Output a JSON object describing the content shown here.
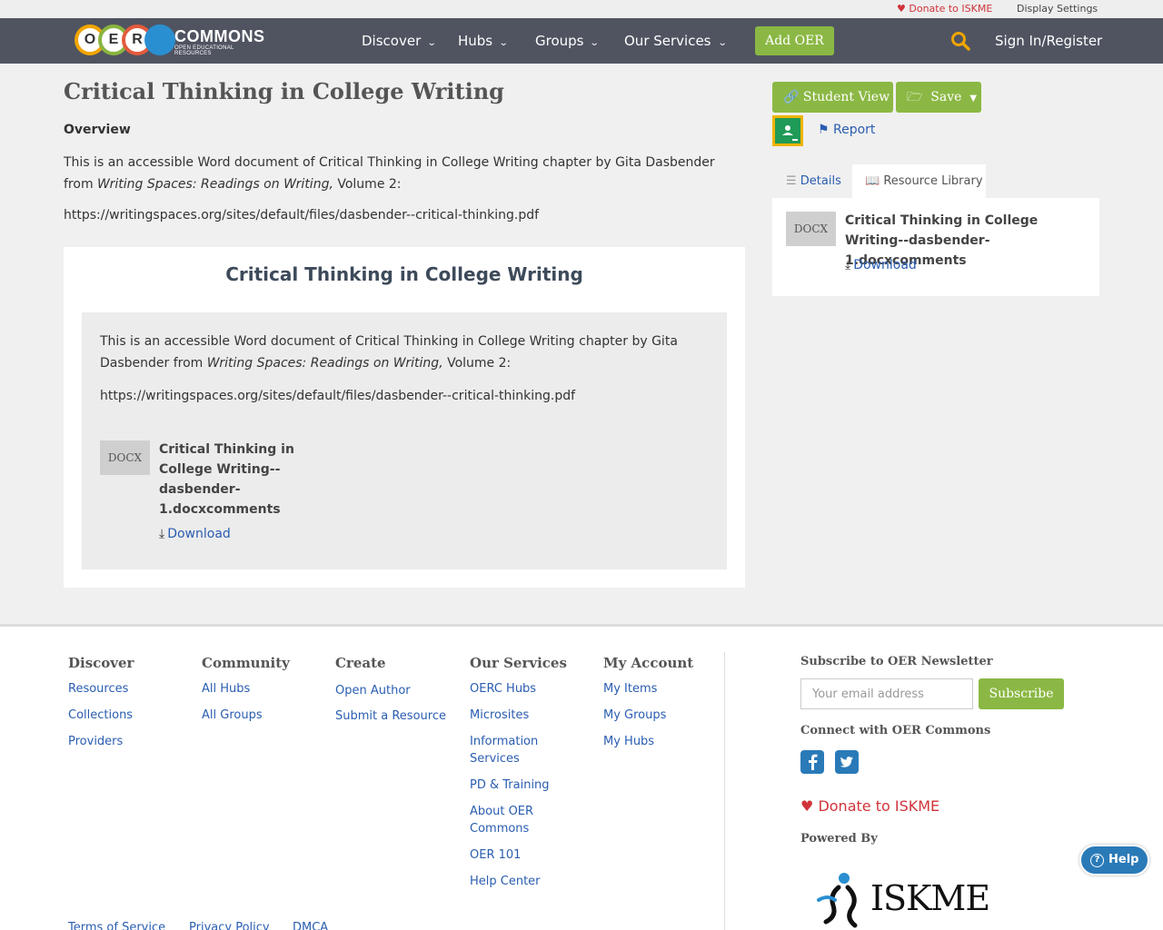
{
  "utility": {
    "donate": "Donate to ISKME",
    "display_settings": "Display Settings"
  },
  "header": {
    "logo_letters": [
      "O",
      "E",
      "R"
    ],
    "logo_word": "COMMONS",
    "logo_sub": "OPEN EDUCATIONAL RESOURCES",
    "nav": [
      "Discover",
      "Hubs",
      "Groups",
      "Our Services"
    ],
    "add_oer": "Add OER",
    "signin": "Sign In/Register"
  },
  "main": {
    "title": "Critical Thinking in College Writing",
    "overview_heading": "Overview",
    "overview_text_a": "This is an accessible Word document of Critical Thinking in College Writing chapter by Gita Dasbender from ",
    "overview_text_em": "Writing Spaces: Readings on Writing,",
    "overview_text_b": " Volume 2:",
    "overview_url": "https://writingspaces.org/sites/default/files/dasbender--critical-thinking.pdf",
    "card_title": "Critical Thinking in College Writing",
    "card_text_a": "This is an accessible Word document of Critical Thinking in College Writing chapter by Gita Dasbender from ",
    "card_text_em": "Writing Spaces: Readings on Writing,",
    "card_text_b": " Volume 2:",
    "card_url": "https://writingspaces.org/sites/default/files/dasbender--critical-thinking.pdf",
    "file_badge": "DOCX",
    "file_name": "Critical Thinking in College Writing--dasbender-1.docxcomments",
    "download": "Download"
  },
  "sidebar": {
    "student_view": "Student View",
    "save": "Save",
    "report": "Report",
    "tabs": [
      "Details",
      "Resource Library"
    ],
    "file_badge": "DOCX",
    "file_name": "Critical Thinking in College Writing--dasbender-1.docxcomments",
    "download": "Download"
  },
  "footer": {
    "columns": [
      {
        "heading": "Discover",
        "links": [
          "Resources",
          "Collections",
          "Providers"
        ]
      },
      {
        "heading": "Community",
        "links": [
          "All Hubs",
          "All Groups"
        ]
      },
      {
        "heading": "Create",
        "links": [
          "Open Author",
          "Submit a Resource"
        ]
      },
      {
        "heading": "Our Services",
        "links": [
          "OERC Hubs",
          "Microsites",
          "Information Services",
          "PD & Training",
          "About OER Commons",
          "OER 101",
          "Help Center"
        ]
      },
      {
        "heading": "My Account",
        "links": [
          "My Items",
          "My Groups",
          "My Hubs"
        ]
      }
    ],
    "newsletter_heading": "Subscribe to OER Newsletter",
    "email_placeholder": "Your email address",
    "subscribe": "Subscribe",
    "connect_heading": "Connect with OER Commons",
    "donate": "Donate to ISKME",
    "powered_by": "Powered By",
    "iskme": "ISKME",
    "legal": [
      "Terms of Service",
      "Privacy Policy",
      "DMCA"
    ],
    "help": "Help"
  },
  "colors": {
    "header_bg": "#505461",
    "accent_green": "#8bb844",
    "link_blue": "#2a5db0",
    "donate_red": "#d0343a"
  }
}
